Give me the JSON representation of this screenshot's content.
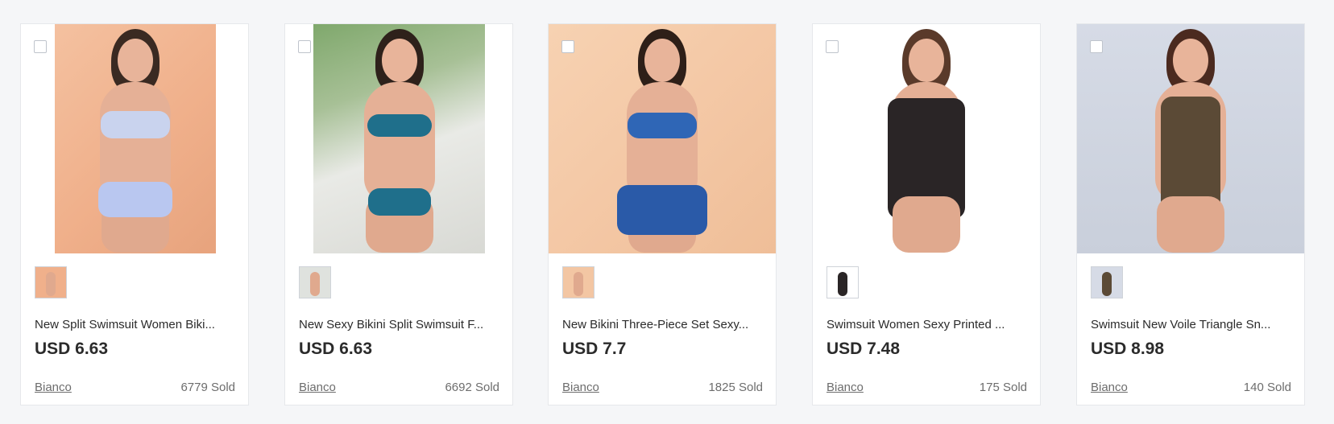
{
  "products": [
    {
      "title": "New Split Swimsuit Women Biki...",
      "price": "USD 6.63",
      "store": "Bianco",
      "sold": "6779 Sold",
      "colors": {
        "top": "#c9d3ee",
        "bottom": "#b9c7f0"
      }
    },
    {
      "title": "New Sexy Bikini Split Swimsuit F...",
      "price": "USD 6.63",
      "store": "Bianco",
      "sold": "6692 Sold",
      "colors": {
        "top": "#1f6f8b",
        "bottom": "#1f6f8b"
      }
    },
    {
      "title": "New Bikini Three-Piece Set Sexy...",
      "price": "USD 7.7",
      "store": "Bianco",
      "sold": "1825 Sold",
      "colors": {
        "top": "#2f66b6",
        "bottom": "#2a5aa8"
      }
    },
    {
      "title": "Swimsuit Women Sexy Printed ...",
      "price": "USD 7.48",
      "store": "Bianco",
      "sold": "175 Sold",
      "colors": {
        "top": "#2a2526",
        "bottom": "#d45a62"
      }
    },
    {
      "title": "Swimsuit New Voile Triangle Sn...",
      "price": "USD 8.98",
      "store": "Bianco",
      "sold": "140 Sold",
      "colors": {
        "top": "#5b4a36",
        "bottom": "#4b3c2c"
      }
    }
  ]
}
